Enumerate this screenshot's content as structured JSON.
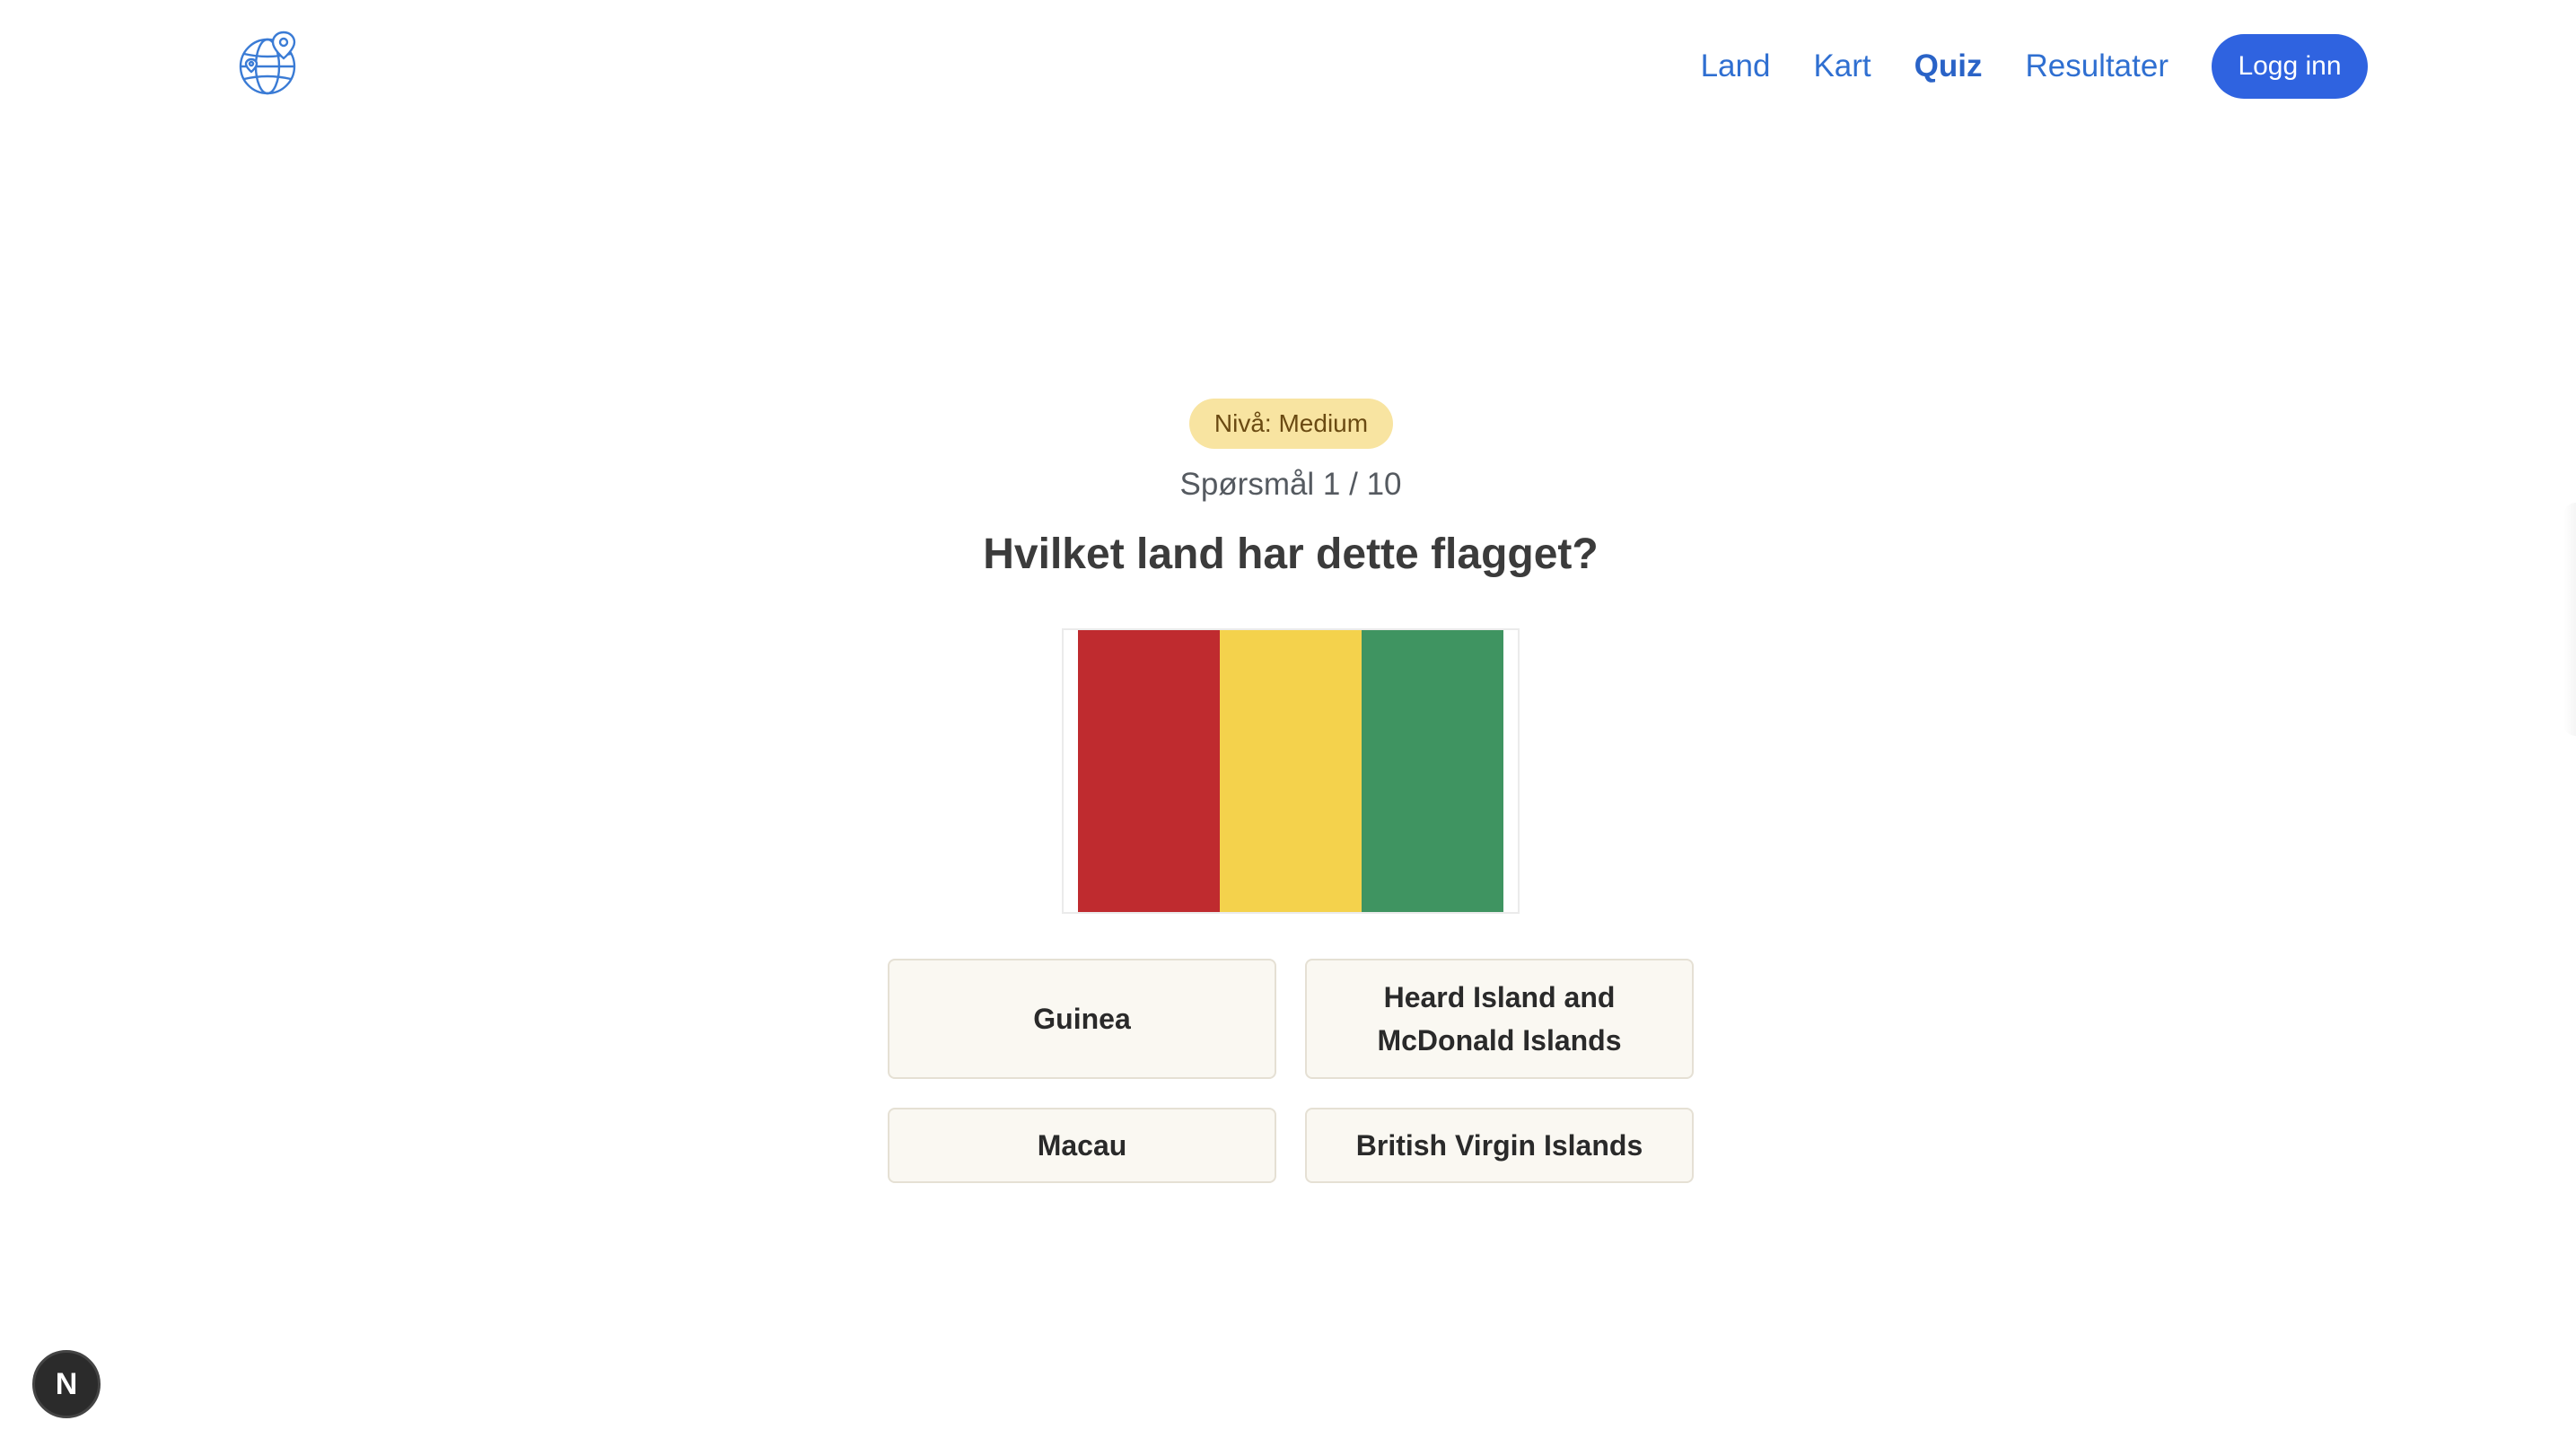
{
  "header": {
    "logo_icon": "globe-location-icon",
    "nav": [
      {
        "label": "Land",
        "active": false
      },
      {
        "label": "Kart",
        "active": false
      },
      {
        "label": "Quiz",
        "active": true
      },
      {
        "label": "Resultater",
        "active": false
      }
    ],
    "login_label": "Logg inn"
  },
  "quiz": {
    "level": "Nivå: Medium",
    "progress": "Spørsmål 1 / 10",
    "question": "Hvilket land har dette flagget?",
    "flag_colors": [
      "#bf2b2f",
      "#f4d24c",
      "#3f9461"
    ],
    "answers": [
      "Guinea",
      "Heard Island and McDonald Islands",
      "Macau",
      "British Virgin Islands"
    ]
  },
  "dev_indicator": {
    "label": "N"
  },
  "colors": {
    "accent": "#2f63e0",
    "badge_bg": "#f8e4a1",
    "answer_bg": "#faf8f2"
  }
}
